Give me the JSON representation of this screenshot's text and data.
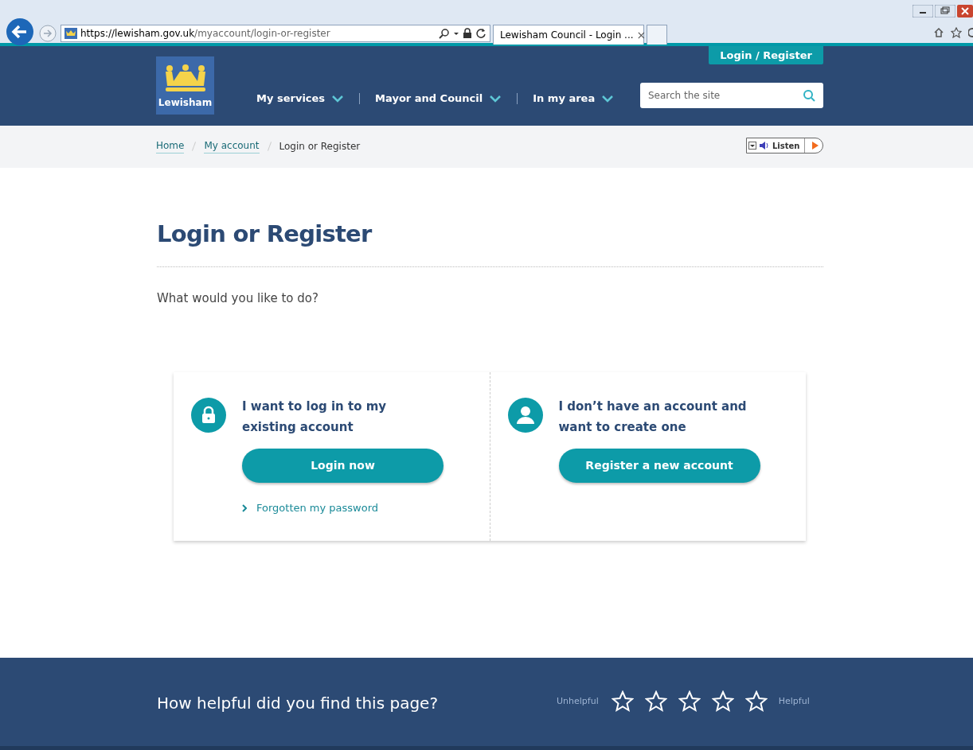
{
  "browser": {
    "address": {
      "host": "https://lewisham.gov.uk",
      "path": "/myaccount/login-or-register"
    },
    "tab": {
      "title": "Lewisham Council - Login ...",
      "close": "×"
    }
  },
  "header": {
    "login_button": "Login / Register",
    "logo_text": "Lewisham",
    "nav": [
      {
        "label": "My services"
      },
      {
        "label": "Mayor and Council"
      },
      {
        "label": "In my area"
      }
    ],
    "search": {
      "placeholder": "Search the site"
    }
  },
  "breadcrumbs": [
    {
      "label": "Home",
      "link": true
    },
    {
      "label": "My account",
      "link": true
    },
    {
      "label": "Login or Register",
      "link": false
    }
  ],
  "listen": "Listen",
  "title": "Login or Register",
  "intro": "What would you like to do?",
  "options": [
    {
      "kind": "lock",
      "heading": "I want to log in to my existing account",
      "button": "Login now",
      "link": "Forgotten my password"
    },
    {
      "kind": "person",
      "heading": "I don’t have an account and want to create one",
      "button": "Register a new account"
    }
  ],
  "feedback": {
    "question": "How helpful did you find this page?",
    "low": "Unhelpful",
    "high": "Helpful",
    "stars": 0
  }
}
